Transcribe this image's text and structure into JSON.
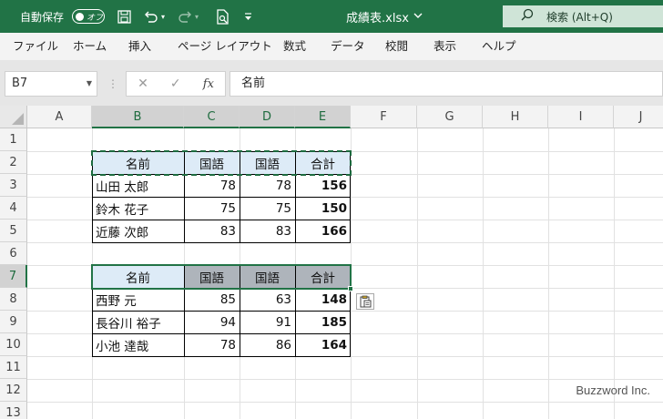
{
  "titlebar": {
    "autosave_label": "自動保存",
    "toggle_text": "オフ",
    "file_name": "成績表.xlsx",
    "search_placeholder": "検索 (Alt+Q)",
    "icons": [
      "save-icon",
      "undo-icon",
      "redo-icon",
      "print-preview-icon",
      "customize-toolbar-icon"
    ]
  },
  "ribbon": {
    "tabs": [
      "ファイル",
      "ホーム",
      "挿入",
      "ページ レイアウト",
      "数式",
      "データ",
      "校閲",
      "表示",
      "ヘルプ"
    ]
  },
  "formula_bar": {
    "name_box": "B7",
    "fx_label": "fx",
    "content": "名前"
  },
  "sheet": {
    "columns": [
      "A",
      "B",
      "C",
      "D",
      "E",
      "F",
      "G",
      "H",
      "I",
      "J"
    ],
    "rows": [
      "1",
      "2",
      "3",
      "4",
      "5",
      "6",
      "7",
      "8",
      "9",
      "10",
      "11",
      "12",
      "13"
    ],
    "table1": {
      "header": [
        "名前",
        "国語",
        "国語",
        "合計"
      ],
      "rows": [
        [
          "山田 太郎",
          "78",
          "78",
          "156"
        ],
        [
          "鈴木 花子",
          "75",
          "75",
          "150"
        ],
        [
          "近藤 次郎",
          "83",
          "83",
          "166"
        ]
      ]
    },
    "table2": {
      "header": [
        "名前",
        "国語",
        "国語",
        "合計"
      ],
      "rows": [
        [
          "西野 元",
          "85",
          "63",
          "148"
        ],
        [
          "長谷川 裕子",
          "94",
          "91",
          "185"
        ],
        [
          "小池 達哉",
          "78",
          "86",
          "164"
        ]
      ]
    },
    "colors": {
      "header_light": "#ddebf7",
      "header_gray": "#aeb4bb",
      "accent": "#217346"
    }
  },
  "watermark": "Buzzword Inc."
}
